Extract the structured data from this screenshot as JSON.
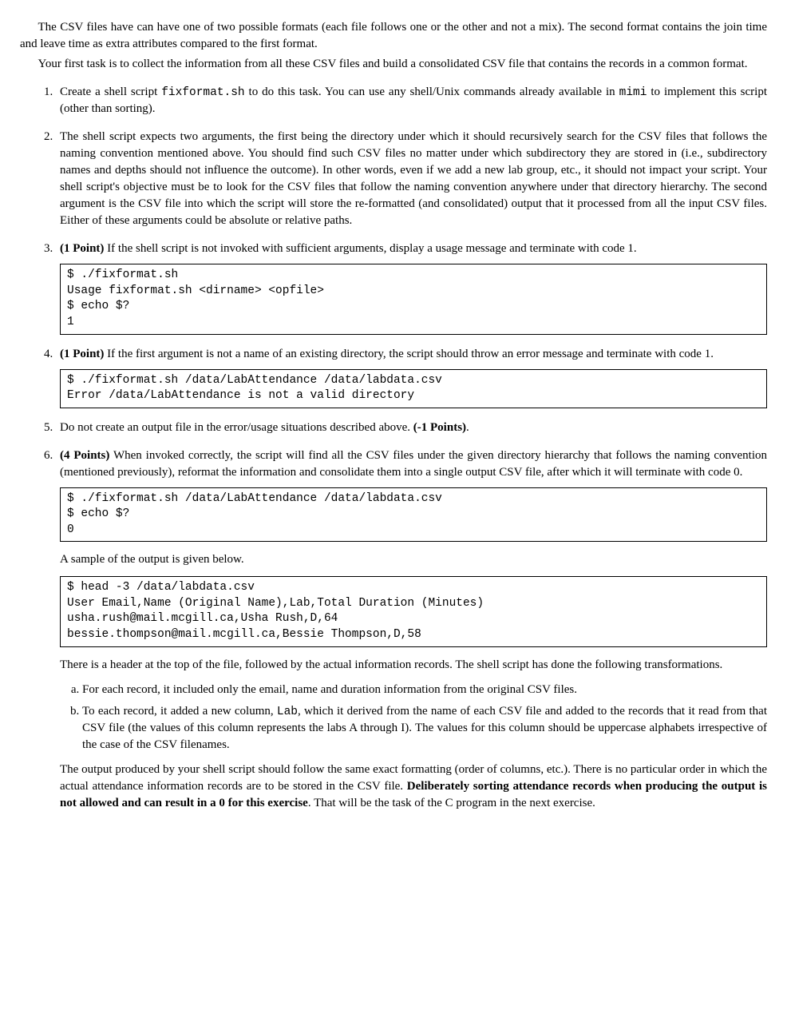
{
  "intro": {
    "p1": "The CSV files have can have one of two possible formats (each file follows one or the other and not a mix). The second format contains the join time and leave time as extra attributes compared to the first format.",
    "p2": "Your first task is to collect the information from all these CSV files and build a consolidated CSV file that contains the records in a common format."
  },
  "items": {
    "i1": {
      "pre": "Create a shell script ",
      "code1": "fixformat.sh",
      "mid": " to do this task. You can use any shell/Unix commands already available in ",
      "code2": "mimi",
      "post": " to implement this script (other than sorting)."
    },
    "i2": "The shell script expects two arguments, the first being the directory under which it should recursively search for the CSV files that follows the naming convention mentioned above. You should find such CSV files no matter under which subdirectory they are stored in (i.e., subdirectory names and depths should not influence the outcome). In other words, even if we add a new lab group, etc., it should not impact your script. Your shell script's objective must be to look for the CSV files that follow the naming convention anywhere under that directory hierarchy. The second argument is the CSV file into which the script will store the re-formatted (and consolidated) output that it processed from all the input CSV files. Either of these arguments could be absolute or relative paths.",
    "i3": {
      "points": "(1 Point)",
      "text": " If the shell script is not invoked with sufficient arguments, display a usage message and terminate with code 1."
    },
    "i4": {
      "points": "(1 Point)",
      "text": " If the first argument is not a name of an existing directory, the script should throw an error message and terminate with code 1."
    },
    "i5": {
      "pre": "Do not create an output file in the error/usage situations described above. ",
      "points": "(-1 Points)",
      "post": "."
    },
    "i6": {
      "points": "(4 Points)",
      "text": " When invoked correctly, the script will find all the CSV files under the given directory hierarchy that follows the naming convention (mentioned previously), reformat the information and consolidate them into a single output CSV file, after which it will terminate with code 0."
    }
  },
  "code": {
    "c3": "$ ./fixformat.sh\nUsage fixformat.sh <dirname> <opfile>\n$ echo $?\n1",
    "c4": "$ ./fixformat.sh /data/LabAttendance /data/labdata.csv\nError /data/LabAttendance is not a valid directory",
    "c6": "$ ./fixformat.sh /data/LabAttendance /data/labdata.csv\n$ echo $?\n0",
    "c6b": "$ head -3 /data/labdata.csv\nUser Email,Name (Original Name),Lab,Total Duration (Minutes)\nusha.rush@mail.mcgill.ca,Usha Rush,D,64\nbessie.thompson@mail.mcgill.ca,Bessie Thompson,D,58"
  },
  "after6": {
    "sample": "A sample of the output is given below.",
    "headerpara": "There is a header at the top of the file, followed by the actual information records. The shell script has done the following transformations.",
    "sub_a": "For each record, it included only the email, name and duration information from the original CSV files.",
    "sub_b": {
      "pre": "To each record, it added a new column, ",
      "code": "Lab",
      "post": ", which it derived from the name of each CSV file and added to the records that it read from that CSV file (the values of this column represents the labs A through I). The values for this column should be uppercase alphabets irrespective of the case of the CSV filenames."
    },
    "finalpara": {
      "pre": "The output produced by your shell script should follow the same exact formatting (order of columns, etc.). There is no particular order in which the actual attendance information records are to be stored in the CSV file. ",
      "bold": "Deliberately sorting attendance records when producing the output is not allowed and can result in a 0 for this exercise",
      "post": ". That will be the task of the C program in the next exercise."
    }
  }
}
